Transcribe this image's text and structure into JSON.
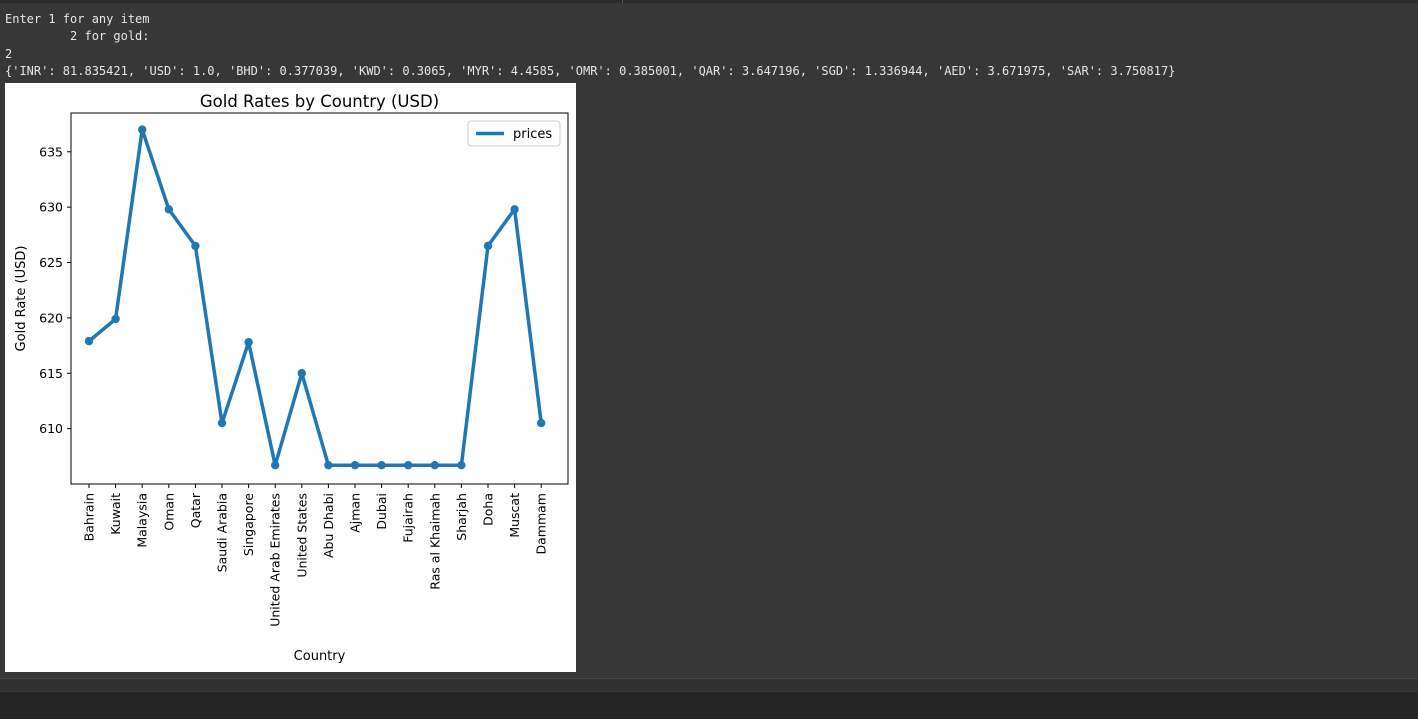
{
  "console": {
    "lines": [
      "Enter 1 for any item",
      "         2 for gold:",
      "2",
      "{'INR': 81.835421, 'USD': 1.0, 'BHD': 0.377039, 'KWD': 0.3065, 'MYR': 4.4585, 'OMR': 0.385001, 'QAR': 3.647196, 'SGD': 1.336944, 'AED': 3.671975, 'SAR': 3.750817}"
    ]
  },
  "colors": {
    "background": "#373737",
    "text": "#e6e6e6",
    "series": "#1f77b4"
  },
  "chart_data": {
    "type": "line",
    "title": "Gold Rates by Country (USD)",
    "xlabel": "Country",
    "ylabel": "Gold Rate (USD)",
    "categories": [
      "Bahrain",
      "Kuwait",
      "Malaysia",
      "Oman",
      "Qatar",
      "Saudi Arabia",
      "Singapore",
      "United Arab Emirates",
      "United States",
      "Abu Dhabi",
      "Ajman",
      "Dubai",
      "Fujairah",
      "Ras al Khaimah",
      "Sharjah",
      "Doha",
      "Muscat",
      "Dammam"
    ],
    "series": [
      {
        "name": "prices",
        "values": [
          617.9,
          619.9,
          637.0,
          629.8,
          626.5,
          610.5,
          617.8,
          606.7,
          615.0,
          606.7,
          606.7,
          606.7,
          606.7,
          606.7,
          606.7,
          626.5,
          629.8,
          610.5
        ]
      }
    ],
    "yticks": [
      610,
      615,
      620,
      625,
      630,
      635
    ],
    "ylim": [
      605.0,
      638.5
    ],
    "grid": false,
    "legend": "top-right",
    "markers": true
  }
}
